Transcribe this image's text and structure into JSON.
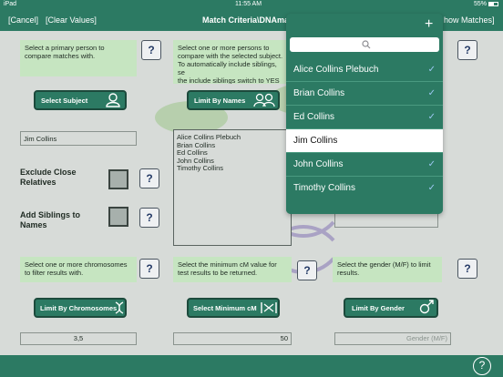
{
  "status_bar": {
    "device": "iPad",
    "time": "11:55 AM",
    "battery": "55%"
  },
  "nav": {
    "cancel": "[Cancel]",
    "clear": "[Clear Values]",
    "title": "Match Criteria\\DNAma",
    "show_matches": "how Matches]"
  },
  "primary": {
    "hint": "Select a primary person to compare matches with.",
    "button": "Select Subject",
    "value": "Jim Collins"
  },
  "names": {
    "hint_line1": "Select one or more persons to",
    "hint_line2": "compare with the selected subject.",
    "hint_line3": "To automatically include siblings, se",
    "hint_line4": "the include siblings switch to YES",
    "button": "Limit By Names",
    "list": [
      "Alice Collins Plebuch",
      "Brian Collins",
      "Ed Collins",
      "John Collins",
      "Timothy Collins"
    ]
  },
  "exclude": {
    "label_line1": "Exclude Close",
    "label_line2": "Relatives"
  },
  "siblings": {
    "label_line1": "Add Siblings to",
    "label_line2": "Names"
  },
  "chromosomes": {
    "hint_line1": "Select one or more chromosomes",
    "hint_line2": "to filter results with.",
    "button": "Limit By Chromosomes",
    "value": "3,5"
  },
  "min_cm": {
    "hint_line1": "Select the minimum cM value for",
    "hint_line2": "test results to be returned.",
    "button": "Select Minimum cM",
    "value": "50"
  },
  "gender": {
    "hint_line1": "Select the gender (M/F) to limit",
    "hint_line2": "results.",
    "button": "Limit By Gender",
    "placeholder": "Gender (M/F)"
  },
  "help_glyph": "?",
  "popover": {
    "add_glyph": "+",
    "items": [
      {
        "name": "Alice Collins Plebuch",
        "check": "✓"
      },
      {
        "name": "Brian Collins",
        "check": "✓"
      },
      {
        "name": "Ed Collins",
        "check": "✓"
      },
      {
        "name": "Jim Collins",
        "check": ""
      },
      {
        "name": "John Collins",
        "check": "✓"
      },
      {
        "name": "Timothy Collins",
        "check": "✓"
      }
    ]
  },
  "colors": {
    "accent": "#2c7a63",
    "hint_bg": "#c6e5c1",
    "check": "#1e6fd0"
  }
}
